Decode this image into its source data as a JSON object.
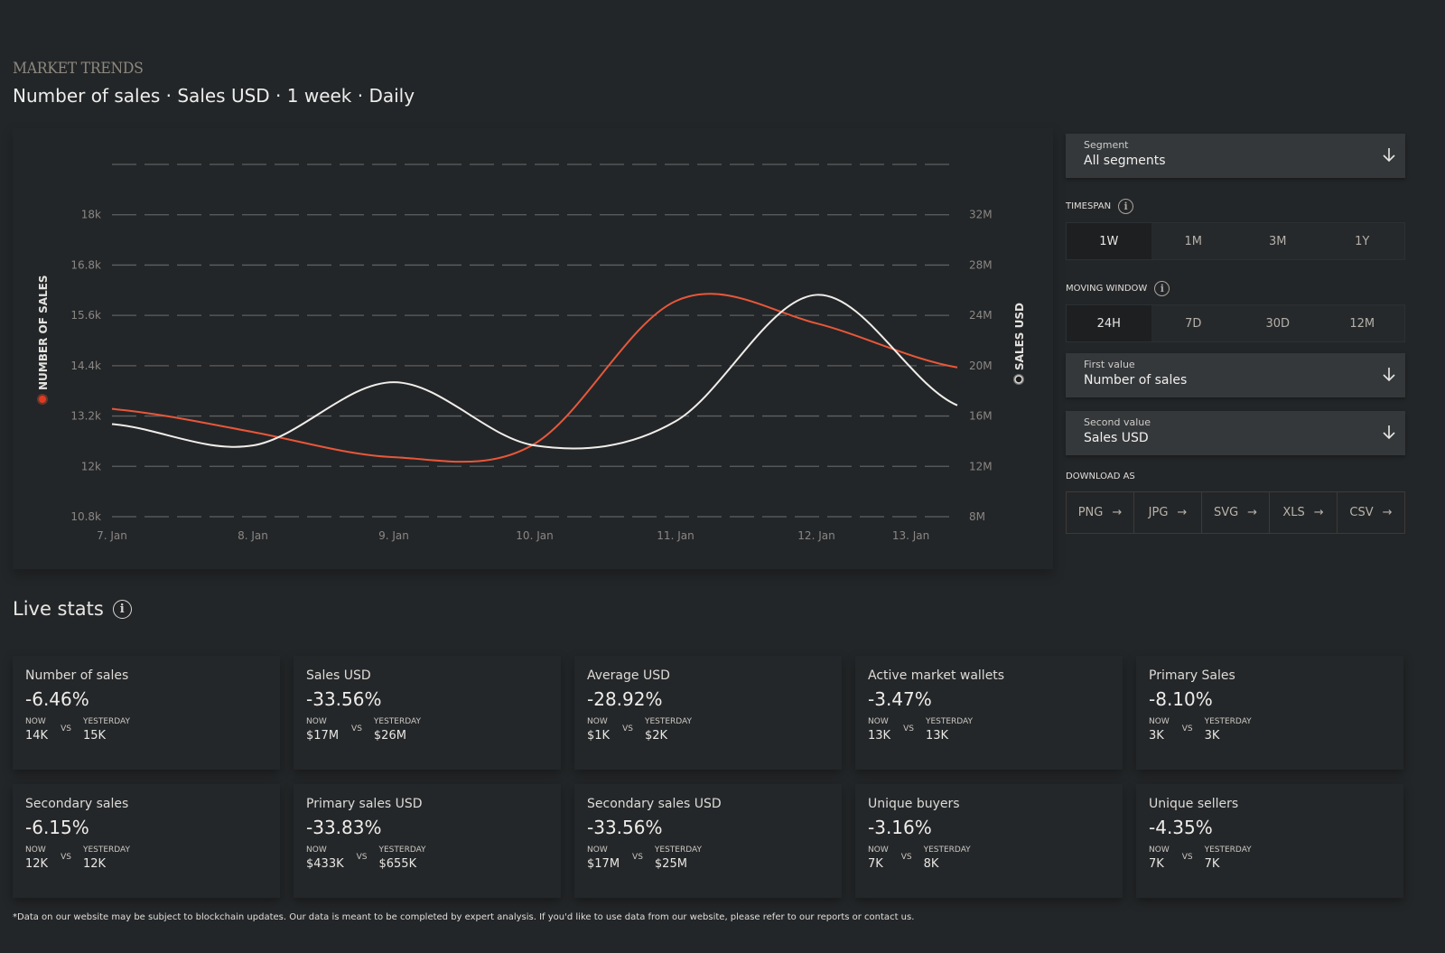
{
  "header": {
    "eyebrow": "MARKET TRENDS",
    "title": "Number of sales · Sales USD · 1 week · Daily"
  },
  "chart_data": {
    "type": "line",
    "title": "Number of sales · Sales USD · 1 week · Daily",
    "x": [
      "7. Jan",
      "8. Jan",
      "9. Jan",
      "10. Jan",
      "11. Jan",
      "12. Jan",
      "13. Jan"
    ],
    "x_tick_labels": [
      "7. Jan",
      "8. Jan",
      "9. Jan",
      "10. Jan",
      "11. Jan",
      "12. Jan",
      "13. Jan"
    ],
    "ylabel": "NUMBER OF SALES",
    "ylabel_right": "SALES USD",
    "y_ticks": [
      "10.8k",
      "12k",
      "13.2k",
      "14.4k",
      "15.6k",
      "16.8k",
      "18k"
    ],
    "y_right_ticks": [
      "8M",
      "12M",
      "16M",
      "20M",
      "24M",
      "28M",
      "32M"
    ],
    "ylim": [
      10800,
      19200
    ],
    "ylim_right": [
      8000000,
      36000000
    ],
    "grid": true,
    "series": [
      {
        "name": "Number of sales",
        "axis": "left",
        "color": "#e8573a",
        "values": [
          13370,
          12820,
          12220,
          12540,
          15940,
          15410,
          14360
        ]
      },
      {
        "name": "Sales USD",
        "axis": "right",
        "color": "#f0eeea",
        "values": [
          15360000,
          13660000,
          18690000,
          13660000,
          15580000,
          25630000,
          16850000
        ]
      }
    ]
  },
  "controls": {
    "segment": {
      "label": "Segment",
      "value": "All segments"
    },
    "timespan": {
      "label": "TIMESPAN",
      "options": [
        "1W",
        "1M",
        "3M",
        "1Y"
      ],
      "selected": "1W"
    },
    "moving_window": {
      "label": "MOVING WINDOW",
      "options": [
        "24H",
        "7D",
        "30D",
        "12M"
      ],
      "selected": "24H"
    },
    "first_value": {
      "label": "First value",
      "value": "Number of sales"
    },
    "second_value": {
      "label": "Second value",
      "value": "Sales USD"
    },
    "download": {
      "label": "DOWNLOAD AS",
      "formats": [
        "PNG",
        "JPG",
        "SVG",
        "XLS",
        "CSV"
      ]
    }
  },
  "live_stats": {
    "title": "Live stats",
    "now_label": "NOW",
    "yesterday_label": "YESTERDAY",
    "vs_label": "VS",
    "cards": [
      {
        "name": "Number of sales",
        "change": "-6.46%",
        "now": "14K",
        "yesterday": "15K"
      },
      {
        "name": "Sales USD",
        "change": "-33.56%",
        "now": "$17M",
        "yesterday": "$26M"
      },
      {
        "name": "Average USD",
        "change": "-28.92%",
        "now": "$1K",
        "yesterday": "$2K"
      },
      {
        "name": "Active market wallets",
        "change": "-3.47%",
        "now": "13K",
        "yesterday": "13K"
      },
      {
        "name": "Primary Sales",
        "change": "-8.10%",
        "now": "3K",
        "yesterday": "3K"
      },
      {
        "name": "Secondary sales",
        "change": "-6.15%",
        "now": "12K",
        "yesterday": "12K"
      },
      {
        "name": "Primary sales USD",
        "change": "-33.83%",
        "now": "$433K",
        "yesterday": "$655K"
      },
      {
        "name": "Secondary sales USD",
        "change": "-33.56%",
        "now": "$17M",
        "yesterday": "$25M"
      },
      {
        "name": "Unique buyers",
        "change": "-3.16%",
        "now": "7K",
        "yesterday": "8K"
      },
      {
        "name": "Unique sellers",
        "change": "-4.35%",
        "now": "7K",
        "yesterday": "7K"
      }
    ]
  },
  "footnote": "*Data on our website may be subject to blockchain updates. Our data is meant to be completed by expert analysis. If you'd like to use data from our website, please refer to our reports or contact us."
}
